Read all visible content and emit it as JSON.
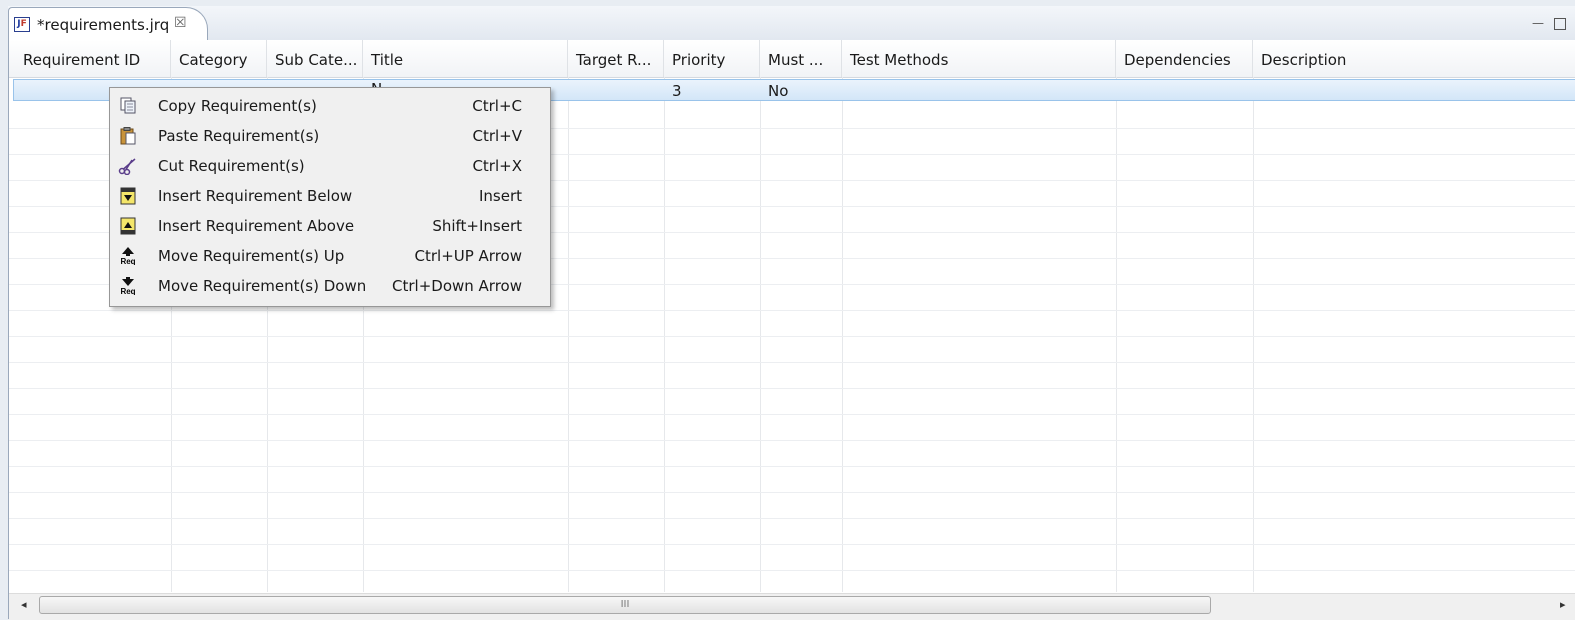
{
  "editor": {
    "tab_title": "*requirements.jrq",
    "tab_close": "☒",
    "icon_letters": {
      "a": "J",
      "b": "F"
    },
    "minimize": "—"
  },
  "table": {
    "columns": [
      "Requirement ID",
      "Category",
      "Sub Cate...",
      "Title",
      "Target R...",
      "Priority",
      "Must ...",
      "Test Methods",
      "Dependencies",
      "Description"
    ],
    "row": {
      "title_partial": "N",
      "priority": "3",
      "must": "No"
    }
  },
  "context_menu": {
    "items": [
      {
        "label": "Copy Requirement(s)",
        "accel": "Ctrl+C",
        "icon": "copy-icon"
      },
      {
        "label": "Paste Requirement(s)",
        "accel": "Ctrl+V",
        "icon": "paste-icon"
      },
      {
        "label": "Cut Requirement(s)",
        "accel": "Ctrl+X",
        "icon": "scissors-icon"
      },
      {
        "label": "Insert Requirement Below",
        "accel": "Insert",
        "icon": "insert-below-icon"
      },
      {
        "label": "Insert Requirement Above",
        "accel": "Shift+Insert",
        "icon": "insert-above-icon"
      },
      {
        "label": "Move Requirement(s) Up",
        "accel": "Ctrl+UP Arrow",
        "icon": "move-up-icon"
      },
      {
        "label": "Move Requirement(s) Down",
        "accel": "Ctrl+Down Arrow",
        "icon": "move-down-icon"
      }
    ]
  },
  "icon_text": {
    "req": "Req"
  },
  "scrollbar": {
    "left_arrow": "◂",
    "right_arrow": "▸",
    "grip": "III"
  }
}
